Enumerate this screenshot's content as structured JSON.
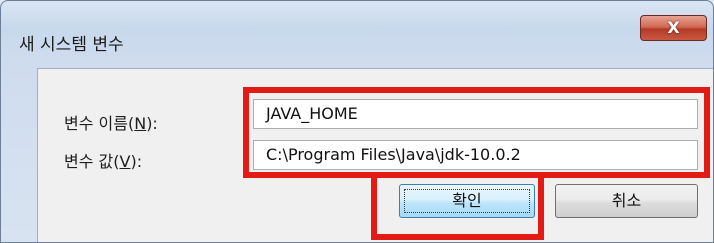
{
  "dialog": {
    "title": "새 시스템 변수",
    "close_glyph": "X"
  },
  "form": {
    "name_label_prefix": "변수 이름(",
    "name_label_key": "N",
    "name_label_suffix": "):",
    "name_value": "JAVA_HOME",
    "value_label_prefix": "변수 값(",
    "value_label_key": "V",
    "value_label_suffix": "):",
    "value_value": "C:\\Program Files\\Java\\jdk-10.0.2"
  },
  "buttons": {
    "ok_label": "확인",
    "cancel_label": "취소"
  },
  "colors": {
    "highlight": "#e21b14",
    "close_button": "#c95a43"
  }
}
